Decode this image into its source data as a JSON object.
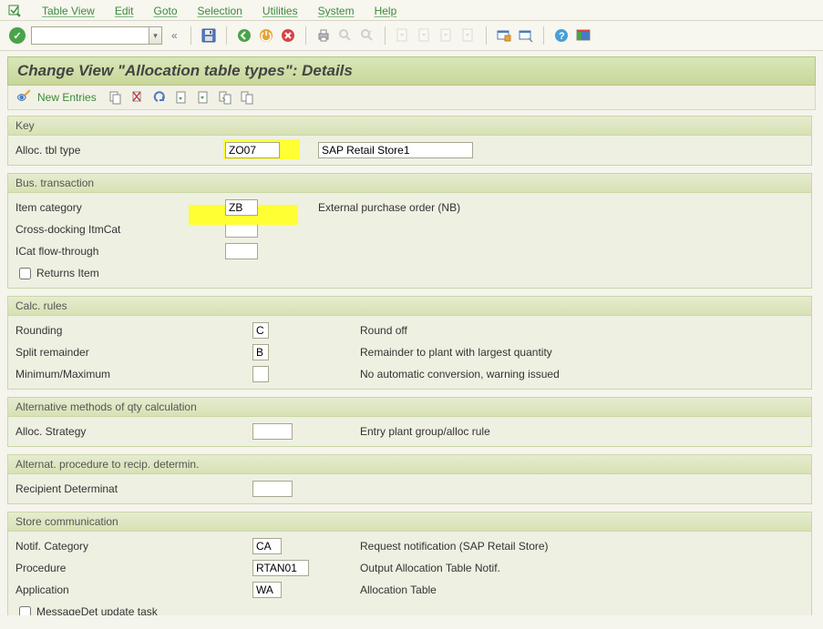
{
  "menu": {
    "table_view": "Table View",
    "edit": "Edit",
    "goto": "Goto",
    "selection": "Selection",
    "utilities": "Utilities",
    "system": "System",
    "help": "Help"
  },
  "title": "Change View \"Allocation table types\": Details",
  "toolbar2": {
    "new_entries": "New Entries"
  },
  "key": {
    "title": "Key",
    "alloc_tbl_type_lbl": "Alloc. tbl type",
    "alloc_tbl_type_val": "ZO07",
    "desc_val": "SAP Retail Store1"
  },
  "bus": {
    "title": "Bus. transaction",
    "item_cat_lbl": "Item category",
    "item_cat_val": "ZB",
    "item_cat_desc": "External purchase order (NB)",
    "cross_dock_lbl": "Cross-docking ItmCat",
    "cross_dock_val": "",
    "flow_lbl": "ICat flow-through",
    "flow_val": "",
    "returns_lbl": "Returns Item"
  },
  "calc": {
    "title": "Calc. rules",
    "rounding_lbl": "Rounding",
    "rounding_val": "C",
    "rounding_desc": "Round off",
    "split_lbl": "Split remainder",
    "split_val": "B",
    "split_desc": "Remainder to plant with largest quantity",
    "minmax_lbl": "Minimum/Maximum",
    "minmax_val": "",
    "minmax_desc": "No automatic conversion, warning issued"
  },
  "alt": {
    "title": "Alternative methods of qty calculation",
    "strategy_lbl": "Alloc. Strategy",
    "strategy_val": "",
    "strategy_desc": "Entry plant group/alloc rule"
  },
  "recip": {
    "title": "Alternat. procedure to recip. determin.",
    "determinat_lbl": "Recipient Determinat",
    "determinat_val": ""
  },
  "store": {
    "title": "Store communication",
    "notif_lbl": "Notif. Category",
    "notif_val": "CA",
    "notif_desc": "Request notification  (SAP Retail Store)",
    "proc_lbl": "Procedure",
    "proc_val": "RTAN01",
    "proc_desc": "Output Allocation Table Notif.",
    "app_lbl": "Application",
    "app_val": "WA",
    "app_desc": "Allocation Table",
    "msgdet_lbl": "MessageDet update task"
  }
}
